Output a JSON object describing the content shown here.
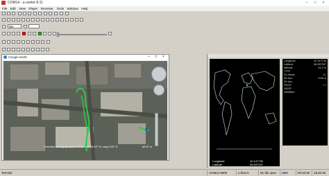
{
  "window": {
    "title": "COM14 - u-center 8.11",
    "minimize": "–",
    "maximize": "□",
    "close": "×"
  },
  "menu": [
    "File",
    "Edit",
    "View",
    "Player",
    "Receiver",
    "Tools",
    "Window",
    "Help"
  ],
  "toolbar": {
    "combo_value": "Wn"
  },
  "google_earth": {
    "title": "Google Earth",
    "attribution": "Données cartographiques ©2013",
    "coords": "Lat 36.53° N  Long 3.00° E",
    "altitude": "alt 57 m"
  },
  "world_map": {
    "labels": [
      "Longitude",
      "Latitude"
    ],
    "values": [
      "10.147730",
      "36.837307"
    ]
  },
  "info_panel": {
    "rows": [
      {
        "k": "Longitude",
        "v": "10.147730",
        "green": false
      },
      {
        "k": "Latitude",
        "v": "36.837307",
        "green": false
      },
      {
        "k": "Altitude",
        "v": "41.0 m",
        "green": false
      },
      {
        "k": "TTFF",
        "v": "",
        "green": false
      },
      {
        "k": "Fix Mode",
        "v": "3D",
        "green": true
      },
      {
        "k": "3D Acc.",
        "v": "0.06 m",
        "green": false
      },
      {
        "k": "2D Acc.",
        "v": "",
        "green": false
      },
      {
        "k": "PDOP",
        "v": "1.5",
        "green": true
      },
      {
        "k": "HDOP",
        "v": "",
        "green": false
      },
      {
        "k": "Satellites",
        "v": "",
        "green": false
      }
    ]
  },
  "statusbar": {
    "ready": "Terminé",
    "port": "COM14 9600",
    "protocol": "u-blox 6",
    "file": "No file open",
    "mode": "UBX",
    "time_elapsed": "00:10:25",
    "clock": "18:40:26"
  },
  "colors": {
    "track": "#2ecc40",
    "info_text": "#d8d8d8",
    "map_bg": "#000000"
  }
}
